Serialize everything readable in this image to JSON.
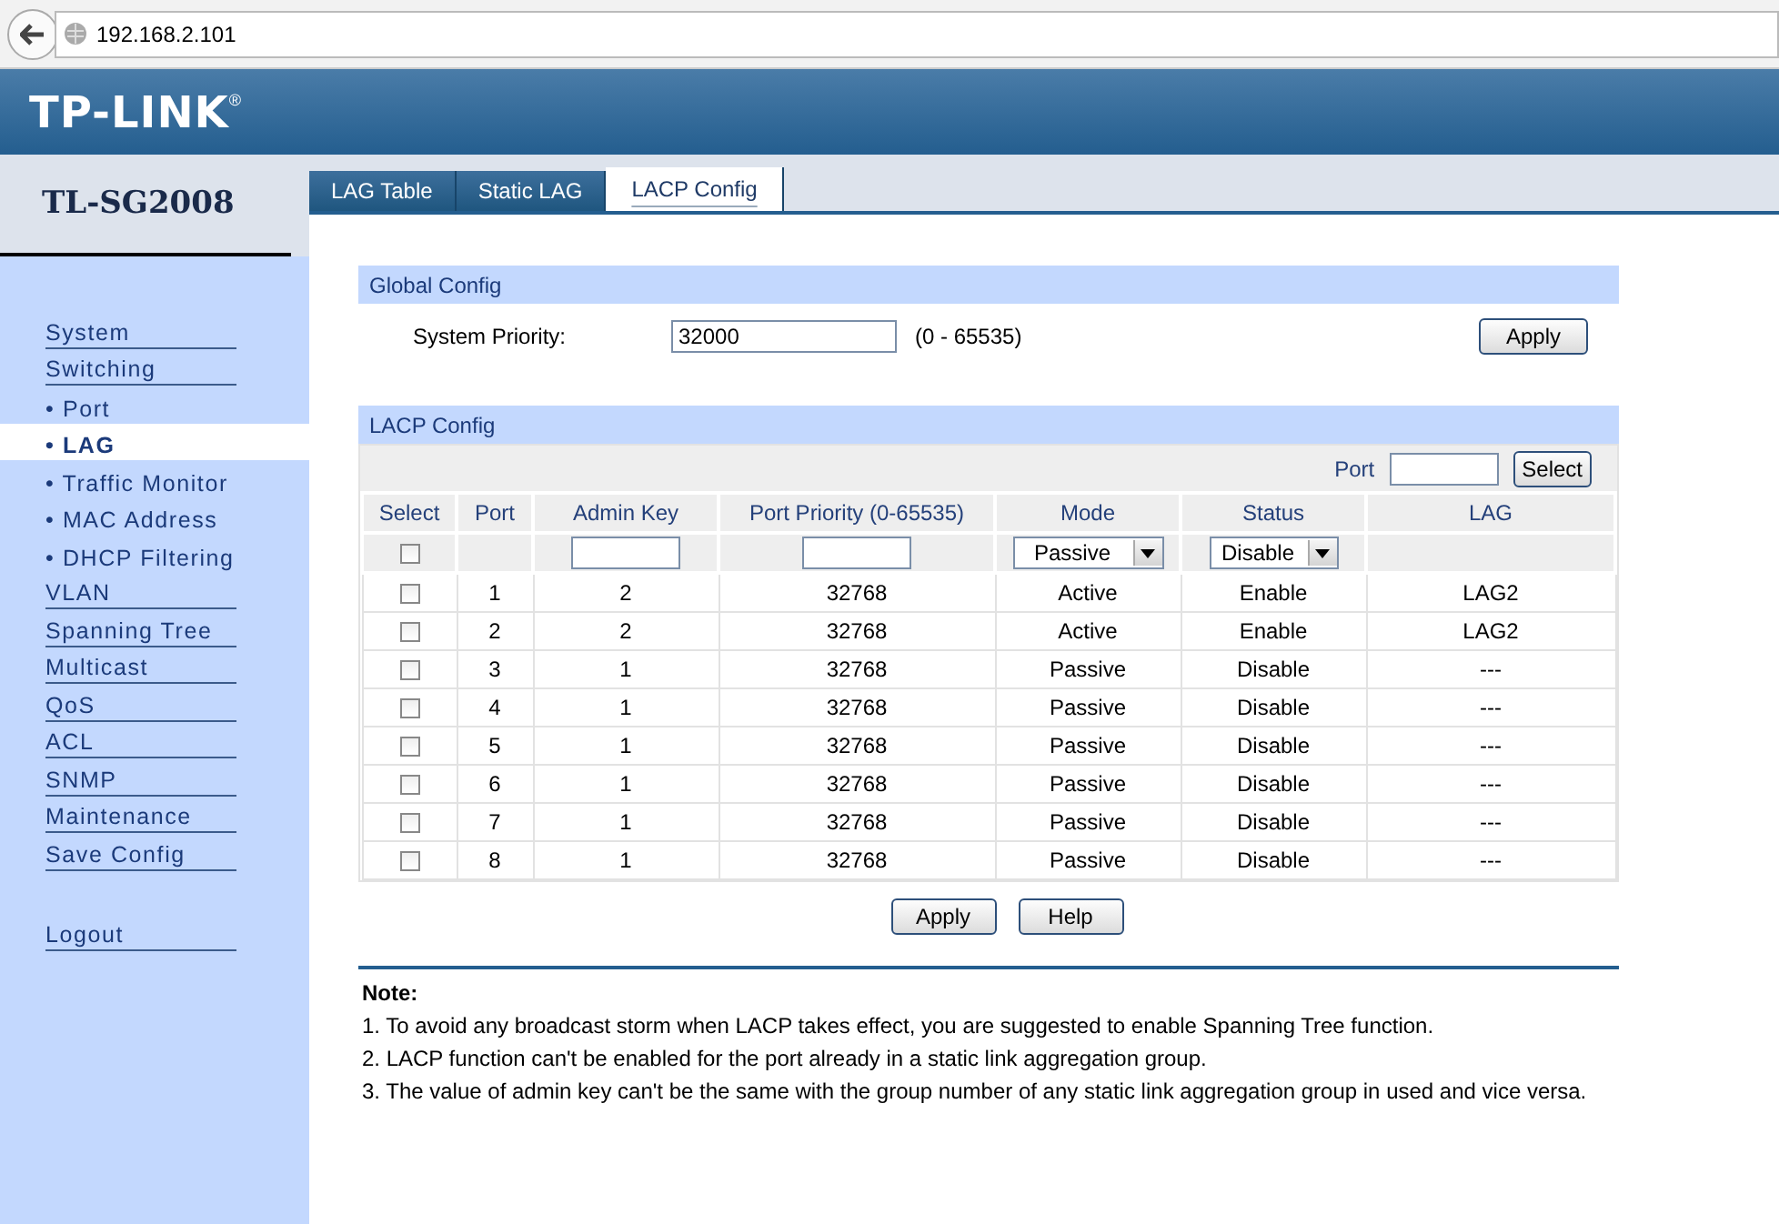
{
  "browser": {
    "address": "192.168.2.101"
  },
  "header": {
    "logo": "TP-LINK",
    "registered_mark": "®"
  },
  "sidebar": {
    "model": "TL-SG2008",
    "items": [
      {
        "label": "System",
        "kind": "section",
        "selected": false
      },
      {
        "label": "Switching",
        "kind": "section",
        "selected": false
      },
      {
        "label": "• Port",
        "kind": "sub",
        "selected": false
      },
      {
        "label": "• LAG",
        "kind": "sub",
        "selected": true
      },
      {
        "label": "• Traffic Monitor",
        "kind": "sub",
        "selected": false
      },
      {
        "label": "• MAC Address",
        "kind": "sub",
        "selected": false
      },
      {
        "label": "• DHCP Filtering",
        "kind": "sub",
        "selected": false
      },
      {
        "label": "VLAN",
        "kind": "section",
        "selected": false
      },
      {
        "label": "Spanning Tree",
        "kind": "section",
        "selected": false
      },
      {
        "label": "Multicast",
        "kind": "section",
        "selected": false
      },
      {
        "label": "QoS",
        "kind": "section",
        "selected": false
      },
      {
        "label": "ACL",
        "kind": "section",
        "selected": false
      },
      {
        "label": "SNMP",
        "kind": "section",
        "selected": false
      },
      {
        "label": "Maintenance",
        "kind": "section",
        "selected": false
      },
      {
        "label": "Save Config",
        "kind": "section",
        "selected": false
      }
    ],
    "logout": "Logout"
  },
  "tabs": [
    {
      "label": "LAG Table",
      "selected": false
    },
    {
      "label": "Static LAG",
      "selected": false
    },
    {
      "label": "LACP Config",
      "selected": true
    }
  ],
  "global_config": {
    "title": "Global Config",
    "label": "System Priority:",
    "value": "32000",
    "range": "(0 - 65535)",
    "button": "Apply"
  },
  "lacp_config": {
    "title": "LACP Config",
    "port_label": "Port",
    "select_button": "Select",
    "columns": [
      "Select",
      "Port",
      "Admin Key",
      "Port Priority (0-65535)",
      "Mode",
      "Status",
      "LAG"
    ],
    "filter": {
      "checked": false,
      "mode": "Passive",
      "status": "Disable"
    },
    "rows": [
      {
        "checked": false,
        "port": "1",
        "admin_key": "2",
        "priority": "32768",
        "mode": "Active",
        "status": "Enable",
        "lag": "LAG2"
      },
      {
        "checked": false,
        "port": "2",
        "admin_key": "2",
        "priority": "32768",
        "mode": "Active",
        "status": "Enable",
        "lag": "LAG2"
      },
      {
        "checked": false,
        "port": "3",
        "admin_key": "1",
        "priority": "32768",
        "mode": "Passive",
        "status": "Disable",
        "lag": "---"
      },
      {
        "checked": false,
        "port": "4",
        "admin_key": "1",
        "priority": "32768",
        "mode": "Passive",
        "status": "Disable",
        "lag": "---"
      },
      {
        "checked": false,
        "port": "5",
        "admin_key": "1",
        "priority": "32768",
        "mode": "Passive",
        "status": "Disable",
        "lag": "---"
      },
      {
        "checked": false,
        "port": "6",
        "admin_key": "1",
        "priority": "32768",
        "mode": "Passive",
        "status": "Disable",
        "lag": "---"
      },
      {
        "checked": false,
        "port": "7",
        "admin_key": "1",
        "priority": "32768",
        "mode": "Passive",
        "status": "Disable",
        "lag": "---"
      },
      {
        "checked": false,
        "port": "8",
        "admin_key": "1",
        "priority": "32768",
        "mode": "Passive",
        "status": "Disable",
        "lag": "---"
      }
    ],
    "buttons": [
      "Apply",
      "Help"
    ]
  },
  "note": {
    "title": "Note:",
    "lines": [
      "1. To avoid any broadcast storm when LACP takes effect, you are suggested to enable Spanning Tree function.",
      "2. LACP function can't be enabled for the port already in a static link aggregation group.",
      "3. The value of admin key can't be the same with the group number of any static link aggregation group in used and vice versa."
    ]
  }
}
